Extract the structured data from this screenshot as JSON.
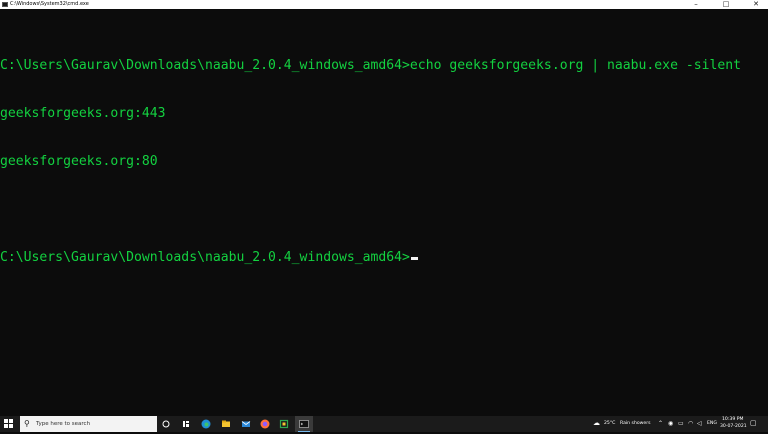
{
  "window": {
    "title": "C:\\Windows\\System32\\cmd.exe",
    "controls": {
      "minimize": "–",
      "maximize": "□",
      "close": "✕"
    }
  },
  "console": {
    "lines": [
      "C:\\Users\\Gaurav\\Downloads\\naabu_2.0.4_windows_amd64>echo geeksforgeeks.org | naabu.exe -silent",
      "geeksforgeeks.org:443",
      "geeksforgeeks.org:80",
      "",
      "C:\\Users\\Gaurav\\Downloads\\naabu_2.0.4_windows_amd64>"
    ],
    "text_color": "#13d140",
    "background": "#0c0c0c"
  },
  "taskbar": {
    "search_placeholder": "Type here to search",
    "apps": [
      "task-view-icon",
      "widgets-icon",
      "edge-icon",
      "file-explorer-icon",
      "mail-icon",
      "firefox-icon",
      "app-icon",
      "cmd-icon"
    ],
    "weather": {
      "temp": "25°C",
      "condition": "Rain showers"
    },
    "language": "ENG",
    "time": "10:39 PM",
    "date": "30-07-2021"
  }
}
